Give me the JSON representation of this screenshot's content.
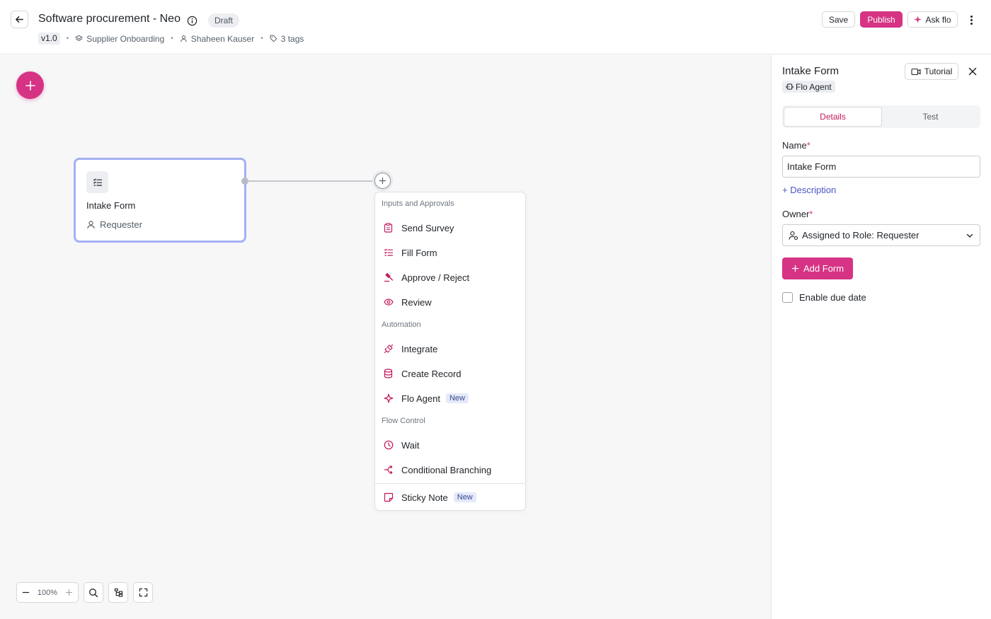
{
  "header": {
    "back_icon": "arrow-left-icon",
    "title": "Software procurement - Neo",
    "status": "Draft",
    "version": "v1.0",
    "category": "Supplier Onboarding",
    "owner": "Shaheen Kauser",
    "tags": "3 tags",
    "save_label": "Save",
    "publish_label": "Publish",
    "askflo_label": "Ask flo"
  },
  "canvas": {
    "node": {
      "title": "Intake Form",
      "role": "Requester"
    },
    "menu": {
      "sections": [
        {
          "title": "Inputs and Approvals"
        },
        {
          "title": "Automation"
        },
        {
          "title": "Flow Control"
        }
      ],
      "items": [
        {
          "label": "Send Survey",
          "icon": "clipboard-icon"
        },
        {
          "label": "Fill Form",
          "icon": "list-check-icon"
        },
        {
          "label": "Approve / Reject",
          "icon": "gavel-icon"
        },
        {
          "label": "Review",
          "icon": "eye-icon"
        },
        {
          "label": "Integrate",
          "icon": "plug-icon"
        },
        {
          "label": "Create Record",
          "icon": "database-icon"
        },
        {
          "label": "Flo Agent",
          "icon": "sparkle-icon",
          "badge": "New"
        },
        {
          "label": "Wait",
          "icon": "clock-icon"
        },
        {
          "label": "Conditional Branching",
          "icon": "branch-icon"
        },
        {
          "label": "Sticky Note",
          "icon": "sticky-note-icon",
          "badge": "New"
        }
      ]
    },
    "zoom": "100%"
  },
  "panel": {
    "title": "Intake Form",
    "agent_tag": "Flo Agent",
    "tutorial_label": "Tutorial",
    "tabs": [
      "Details",
      "Test"
    ],
    "name_label": "Name",
    "name_value": "Intake Form",
    "description_link": "+ Description",
    "owner_label": "Owner",
    "owner_value": "Assigned to Role: Requester",
    "add_form_label": "Add Form",
    "due_date_label": "Enable due date"
  },
  "colors": {
    "accent": "#d63384",
    "node_border": "#a5b0f2",
    "link": "#4a56c4"
  }
}
